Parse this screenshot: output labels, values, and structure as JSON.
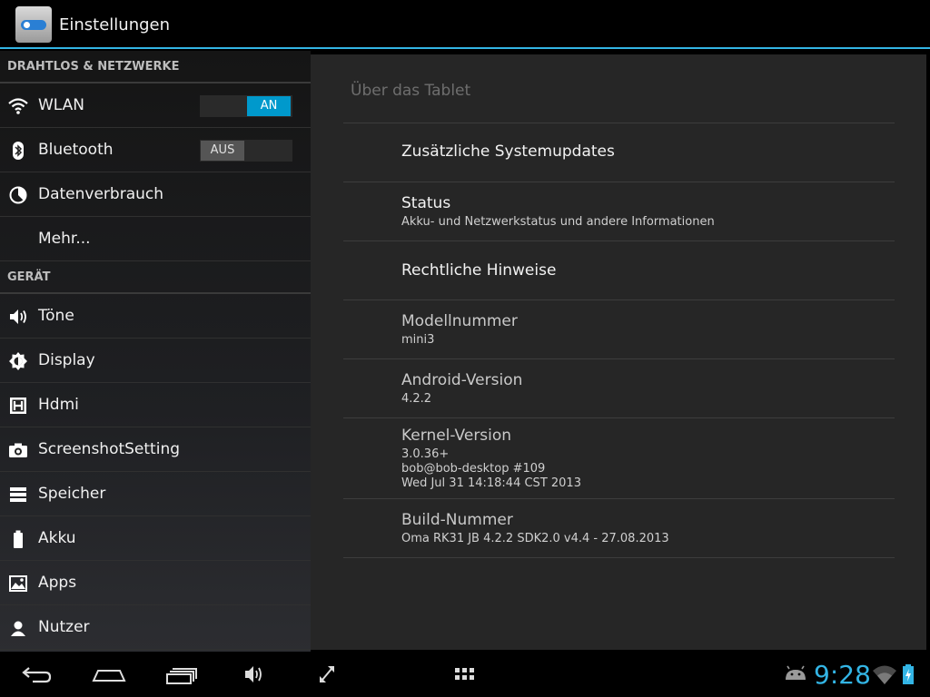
{
  "app": {
    "title": "Einstellungen",
    "icon": "settings-app-icon"
  },
  "sidebar": {
    "sections": [
      {
        "header": "DRAHTLOS & NETZWERKE"
      },
      {
        "header": "GERÄT"
      }
    ],
    "items": [
      {
        "label": "WLAN",
        "icon": "wifi-icon",
        "toggle": "AN"
      },
      {
        "label": "Bluetooth",
        "icon": "bluetooth-icon",
        "toggle": "AUS"
      },
      {
        "label": "Datenverbrauch",
        "icon": "data-usage-icon"
      },
      {
        "label": "Mehr..."
      },
      {
        "label": "Töne",
        "icon": "speaker-icon"
      },
      {
        "label": "Display",
        "icon": "brightness-icon"
      },
      {
        "label": "Hdmi",
        "icon": "hdmi-icon"
      },
      {
        "label": "ScreenshotSetting",
        "icon": "camera-icon"
      },
      {
        "label": "Speicher",
        "icon": "storage-icon"
      },
      {
        "label": "Akku",
        "icon": "battery-icon"
      },
      {
        "label": "Apps",
        "icon": "apps-icon"
      },
      {
        "label": "Nutzer",
        "icon": "user-icon"
      }
    ]
  },
  "content": {
    "title": "Über das Tablet",
    "prefs": [
      {
        "title": "Zusätzliche Systemupdates"
      },
      {
        "title": "Status",
        "summary": "Akku- und Netzwerkstatus und andere Informationen"
      },
      {
        "title": "Rechtliche Hinweise"
      },
      {
        "title": "Modellnummer",
        "summary": "mini3"
      },
      {
        "title": "Android-Version",
        "summary": "4.2.2"
      },
      {
        "title": "Kernel-Version",
        "summary_lines": [
          "3.0.36+",
          "bob@bob-desktop #109",
          "Wed Jul 31 14:18:44 CST 2013"
        ]
      },
      {
        "title": "Build-Nummer",
        "summary": "Oma RK31 JB 4.2.2 SDK2.0 v4.4 - 27.08.2013"
      }
    ]
  },
  "navbar": {
    "clock": "9:28",
    "accent": "#33b5e5",
    "buttons": [
      "back-icon",
      "home-icon",
      "recent-apps-icon",
      "volume-icon",
      "fullscreen-icon",
      "app-drawer-icon"
    ],
    "status_icons": [
      "android-debug-icon",
      "wifi-signal-icon",
      "battery-charging-icon"
    ]
  }
}
